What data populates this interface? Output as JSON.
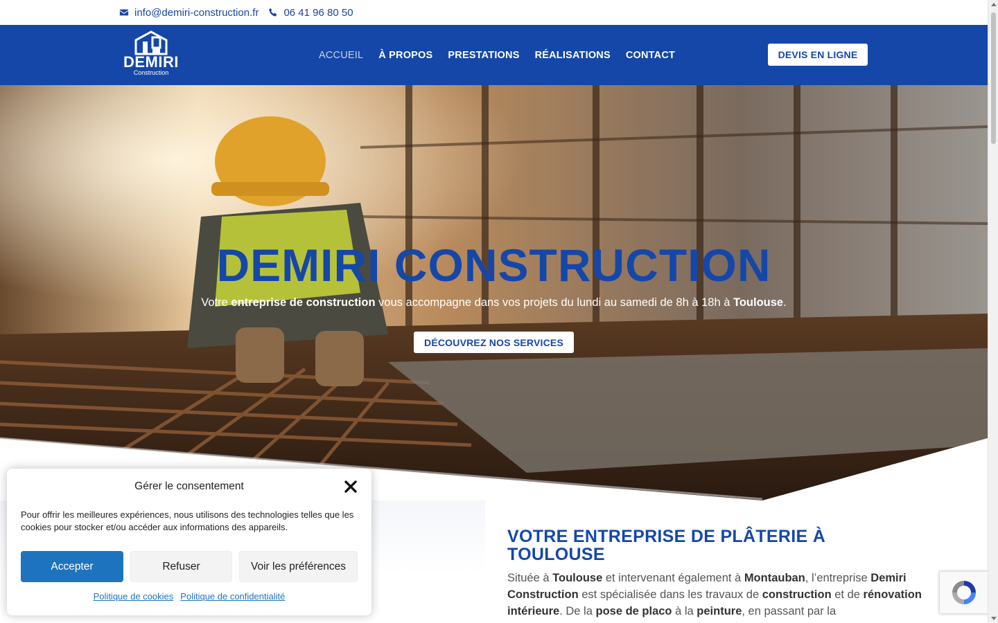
{
  "topbar": {
    "email": "info@demiri-construction.fr",
    "phone": "06 41 96 80 50"
  },
  "header": {
    "logo_name": "DEMIRI",
    "logo_sub": "Construction",
    "nav": [
      "ACCUEIL",
      "À PROPOS",
      "PRESTATIONS",
      "RÉALISATIONS",
      "CONTACT"
    ],
    "cta": "DEVIS EN LIGNE"
  },
  "hero": {
    "title": "DEMIRI CONSTRUCTION",
    "subtitle_parts": [
      "Votre ",
      "entreprise de construction",
      " vous accompagne dans vos projets du lundi au samedi de 8h à 18h à ",
      "Toulouse",
      "."
    ],
    "button": "DÉCOUVREZ NOS SERVICES"
  },
  "section": {
    "title": "VOTRE ENTREPRISE DE PLÂTERIE À TOULOUSE",
    "text_parts": [
      "Située à ",
      "Toulouse",
      " et intervenant également à ",
      "Montauban",
      ", l’entreprise ",
      "Demiri Construction",
      " est spécialisée dans les travaux de ",
      "construction",
      " et de ",
      "rénovation intérieure",
      ". De la ",
      "pose de placo",
      " à la ",
      "peinture",
      ", en passant par la"
    ]
  },
  "consent": {
    "title": "Gérer le consentement",
    "text": "Pour offrir les meilleures expériences, nous utilisons des technologies telles que les cookies pour stocker et/ou accéder aux informations des appareils.",
    "accept": "Accepter",
    "refuse": "Refuser",
    "preferences": "Voir les préférences",
    "link_cookies": "Politique de cookies",
    "link_privacy": "Politique de confidentialité"
  },
  "colors": {
    "brand_blue": "#1547a8",
    "accept_blue": "#1e73be"
  },
  "icons": [
    "envelope-icon",
    "phone-icon",
    "close-icon",
    "recaptcha-icon"
  ]
}
